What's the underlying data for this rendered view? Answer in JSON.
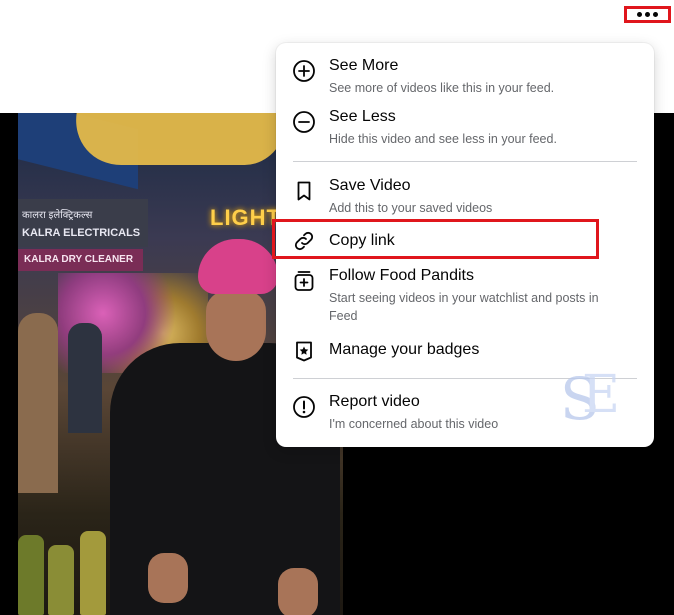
{
  "more_button": {
    "icon": "more-horizontal-icon"
  },
  "menu": {
    "items": [
      {
        "icon": "plus-circle-icon",
        "title": "See More",
        "description": "See more of videos like this in your feed."
      },
      {
        "icon": "minus-circle-icon",
        "title": "See Less",
        "description": "Hide this video and see less in your feed."
      },
      {
        "icon": "bookmark-icon",
        "title": "Save Video",
        "description": "Add this to your saved videos"
      },
      {
        "icon": "link-icon",
        "title": "Copy link",
        "description": ""
      },
      {
        "icon": "follow-watchlist-icon",
        "title": "Follow Food Pandits",
        "description": "Start seeing videos in your watchlist and posts in Feed"
      },
      {
        "icon": "badge-star-icon",
        "title": "Manage your badges",
        "description": ""
      },
      {
        "icon": "report-alert-icon",
        "title": "Report video",
        "description": "I'm concerned about this video"
      }
    ]
  },
  "video": {
    "signs": {
      "hindi": "कालरा इलेक्ट्रिकल्स",
      "shop": "KALRA ELECTRICALS",
      "cleaner": "KALRA DRY CLEANER",
      "neon": "LIGHT"
    }
  },
  "colors": {
    "highlight": "#e0161c",
    "menu_text": "#050505",
    "secondary_text": "#65676b",
    "divider": "#ced0d4"
  }
}
